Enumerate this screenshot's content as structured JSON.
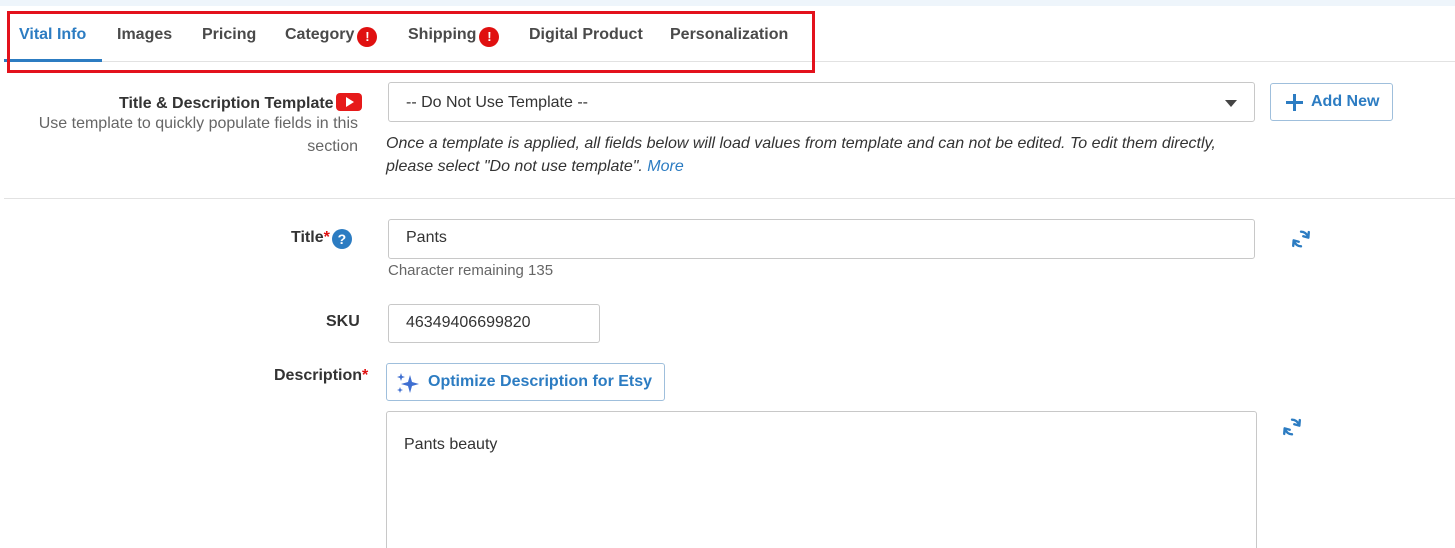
{
  "tabs": [
    {
      "label": "Vital Info",
      "active": true,
      "alert": false
    },
    {
      "label": "Images",
      "active": false,
      "alert": false
    },
    {
      "label": "Pricing",
      "active": false,
      "alert": false
    },
    {
      "label": "Category",
      "active": false,
      "alert": true
    },
    {
      "label": "Shipping",
      "active": false,
      "alert": true
    },
    {
      "label": "Digital Product",
      "active": false,
      "alert": false
    },
    {
      "label": "Personalization",
      "active": false,
      "alert": false
    }
  ],
  "alert_glyph": "!",
  "template": {
    "label": "Title & Description Template",
    "sublabel": "Use template to quickly populate fields in this section",
    "selected": "-- Do Not Use Template --",
    "add_new_label": "Add New",
    "note": "Once a template is applied, all fields below will load values from template and can not be edited. To edit them directly, please select \"Do not use template\".",
    "more_link": "More"
  },
  "title_field": {
    "label": "Title",
    "required_mark": "*",
    "help_glyph": "?",
    "value": "Pants",
    "char_remaining": "Character remaining 135"
  },
  "sku_field": {
    "label": "SKU",
    "value": "46349406699820"
  },
  "description_field": {
    "label": "Description",
    "required_mark": "*",
    "optimize_label": "Optimize Description for Etsy",
    "value": "Pants beauty"
  },
  "colors": {
    "accent": "#2c7cc2",
    "alert": "#e01010",
    "highlight_box": "#e3121c",
    "youtube": "#e61a1a"
  },
  "icons": [
    "youtube-icon",
    "chevron-down-icon",
    "plus-icon",
    "help-icon",
    "refresh-icon",
    "sparkle-icon",
    "alert-icon"
  ]
}
